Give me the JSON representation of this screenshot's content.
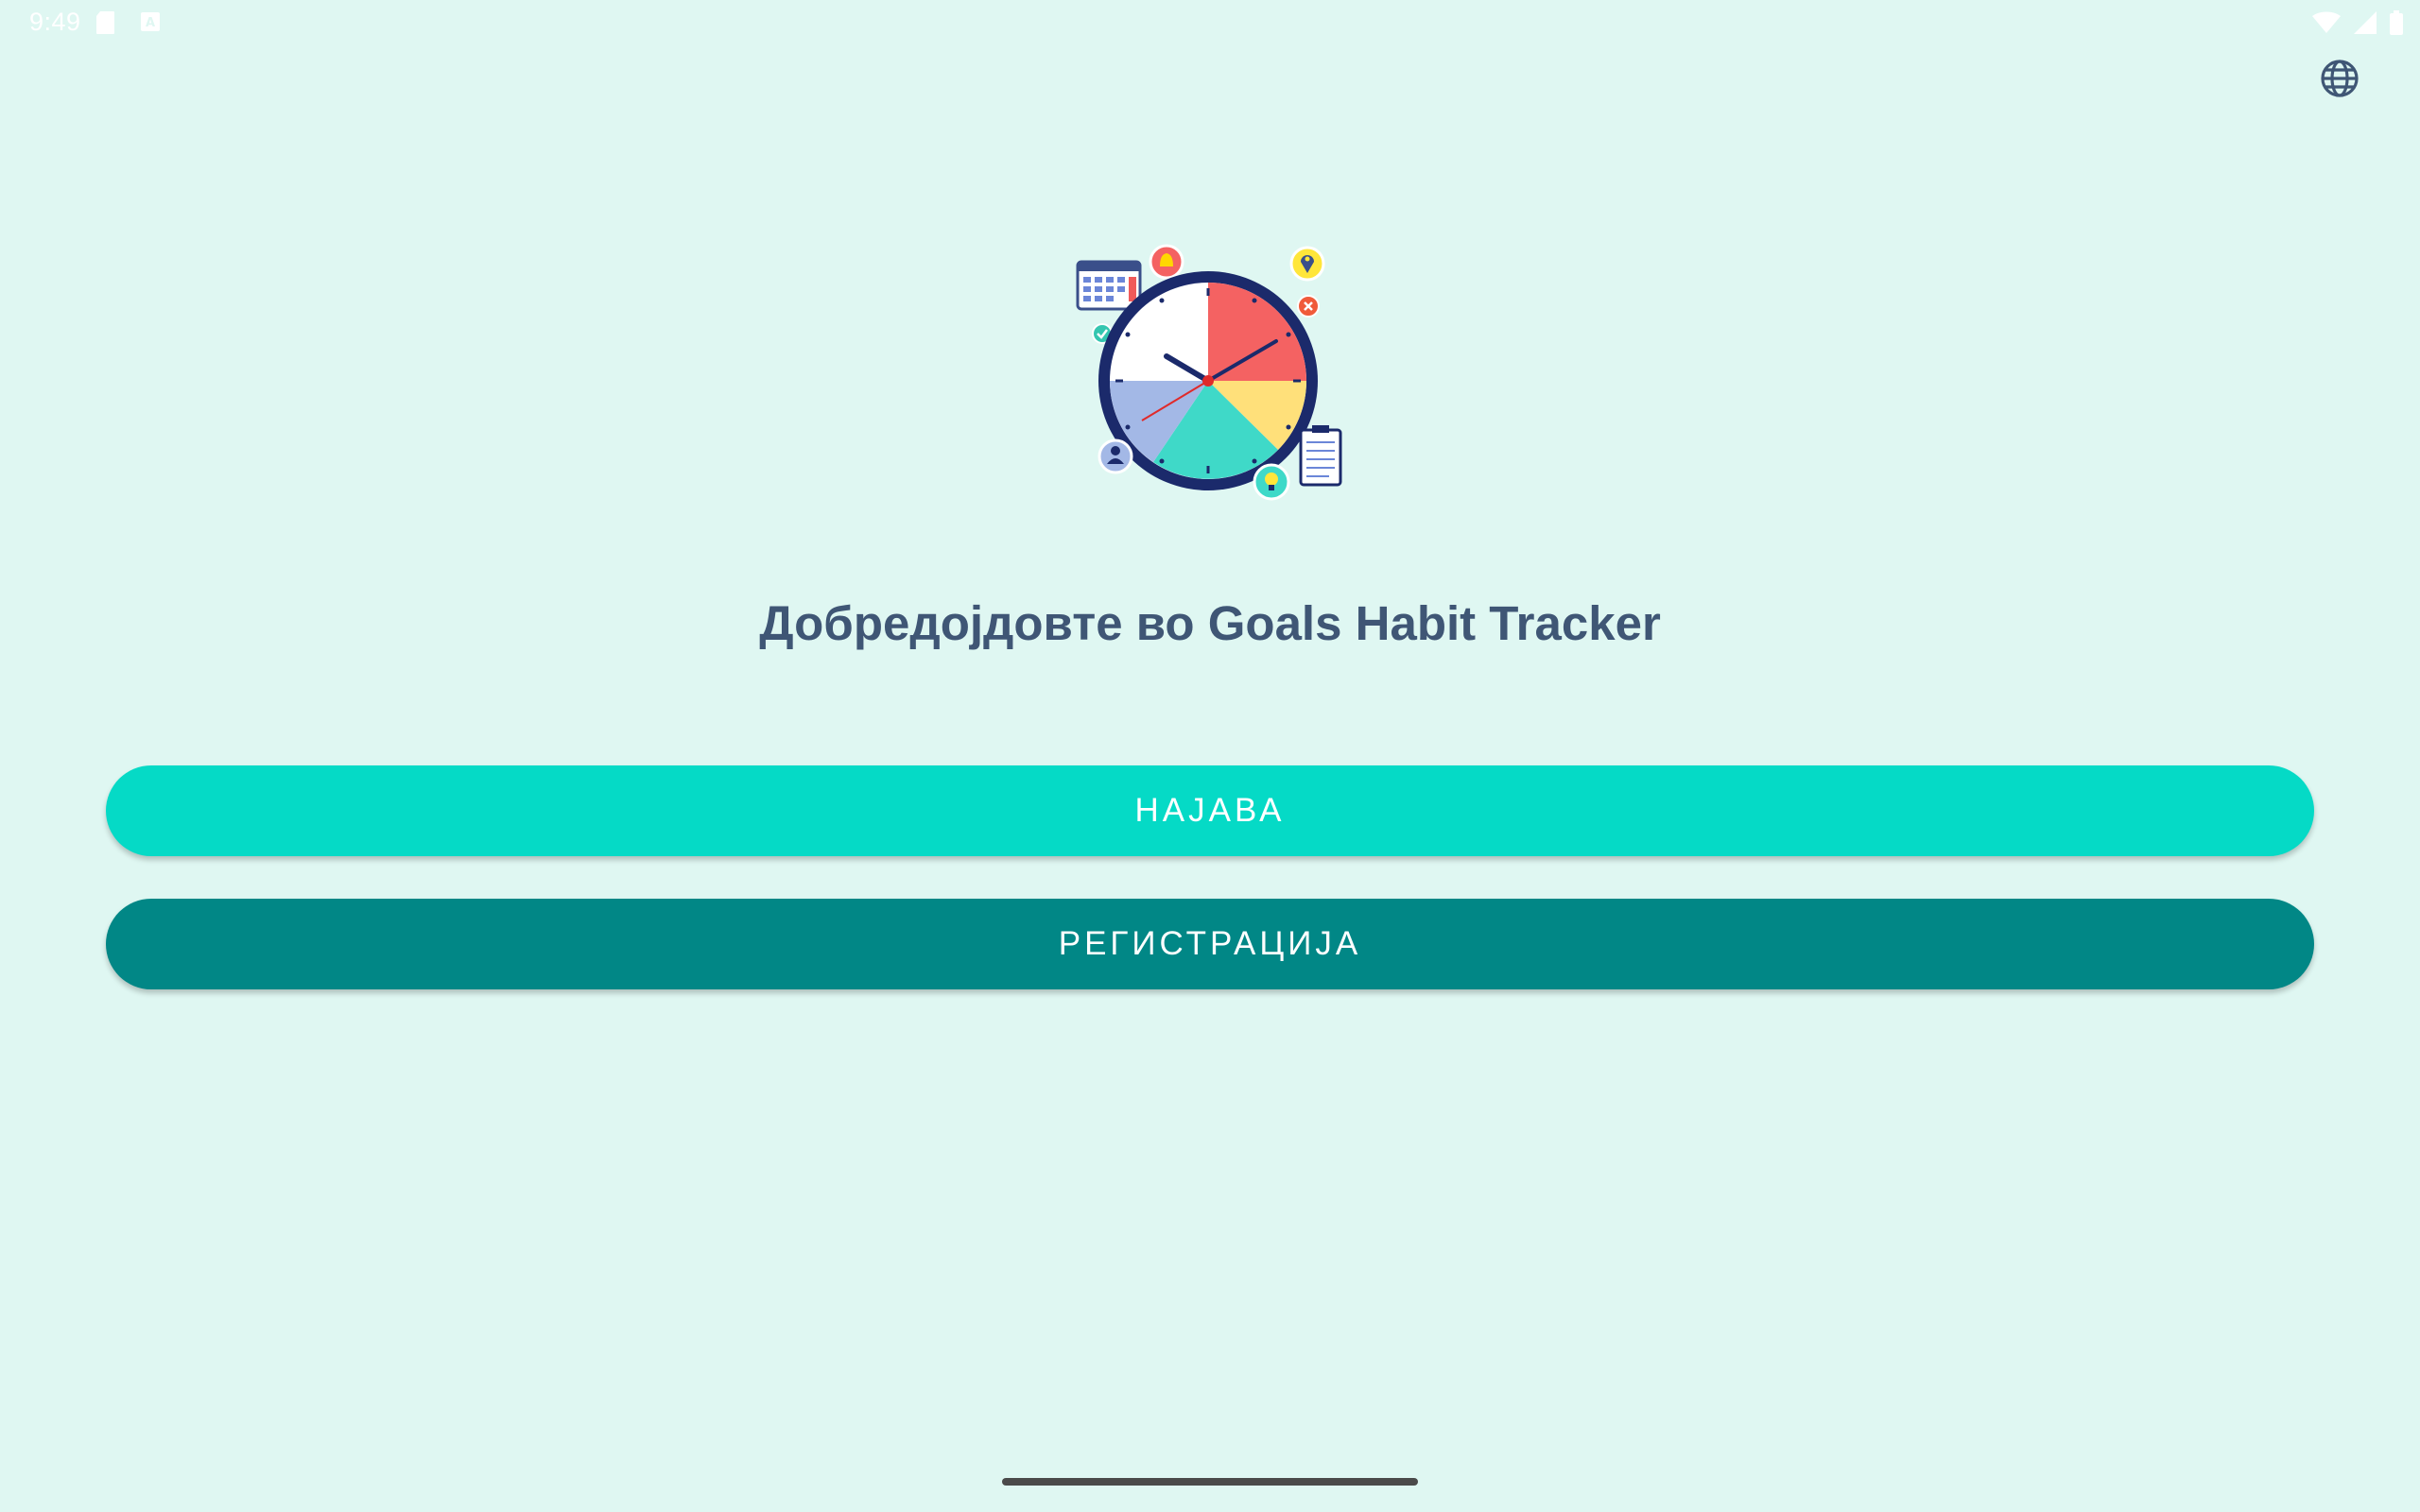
{
  "status_bar": {
    "time": "9:49",
    "icons": [
      "sd-card-icon",
      "keyboard-a-icon",
      "wifi-icon",
      "signal-icon",
      "battery-icon"
    ]
  },
  "toolbar": {
    "language_icon": "globe-icon"
  },
  "logo": {
    "icon": "clock-habit-logo"
  },
  "welcome": {
    "title": "Добредојдовте во Goals Habit Tracker"
  },
  "actions": {
    "login_label": "НАЈАВА",
    "register_label": "РЕГИСТРАЦИЈА"
  },
  "colors": {
    "background": "#dff7f2",
    "title": "#3f5675",
    "login_button": "#05dac6",
    "register_button": "#018786"
  }
}
